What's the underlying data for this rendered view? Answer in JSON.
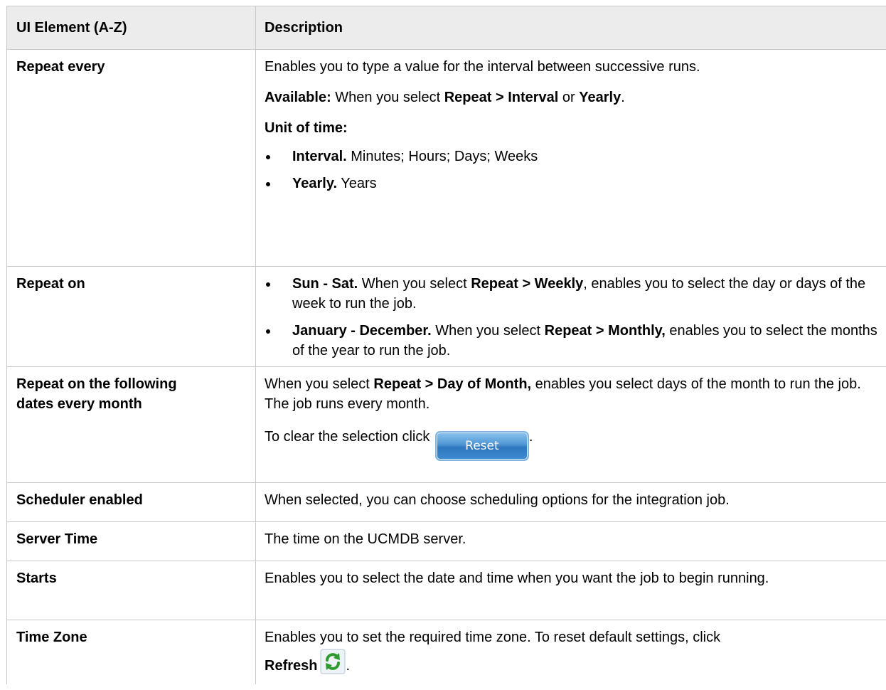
{
  "table": {
    "header": {
      "col_element": "UI Element (A-Z)",
      "col_description": "Description"
    },
    "rows": {
      "repeat_every": {
        "name": "Repeat every",
        "desc_line1": "Enables you to type a value for the interval between successive runs.",
        "available_label": "Available:",
        "available_text1": " When you select ",
        "available_bold1": "Repeat > Interval",
        "available_text2": " or ",
        "available_bold2": "Yearly",
        "available_text3": ".",
        "unit_label": "Unit of time:",
        "bullets": [
          {
            "bold": "Interval.",
            "text": " Minutes; Hours; Days; Weeks"
          },
          {
            "bold": "Yearly.",
            "text": " Years"
          }
        ]
      },
      "repeat_on": {
        "name": "Repeat on",
        "bullets": [
          {
            "bold": "Sun - Sat.",
            "text1": " When you select ",
            "bold2": "Repeat > Weekly",
            "text2": ", enables you to select the day or days of the week to run the job."
          },
          {
            "bold": "January - December.",
            "text1": " When you select ",
            "bold2": "Repeat > Monthly,",
            "text2": " enables you to select the months of the year to run the job."
          }
        ]
      },
      "repeat_dates": {
        "name_line1": "Repeat on the following",
        "name_line2": "dates every month",
        "text1": "When you select ",
        "bold1": "Repeat > Day of Month,",
        "text2": " enables you select days of the month to run the job. The job runs every month.",
        "clear_text": "To clear the selection click ",
        "reset_button_label": "Reset",
        "clear_end": "."
      },
      "scheduler_enabled": {
        "name": "Scheduler enabled",
        "desc": "When selected, you can choose scheduling options for the integration job."
      },
      "server_time": {
        "name": "Server Time",
        "desc": "The time on the UCMDB server."
      },
      "starts": {
        "name": "Starts",
        "desc": "Enables you to select the date and time when you want the job to begin running."
      },
      "time_zone": {
        "name": "Time Zone",
        "desc": "Enables you to set the required time zone. To reset default settings, click",
        "refresh_label": "Refresh",
        "end": "."
      }
    }
  },
  "colors": {
    "header_bg": "#ececec",
    "border": "#c8c8c8",
    "reset_button": "#3f8ad0",
    "refresh_icon": "#3aa63a"
  },
  "icons": {
    "refresh": "refresh-icon"
  }
}
